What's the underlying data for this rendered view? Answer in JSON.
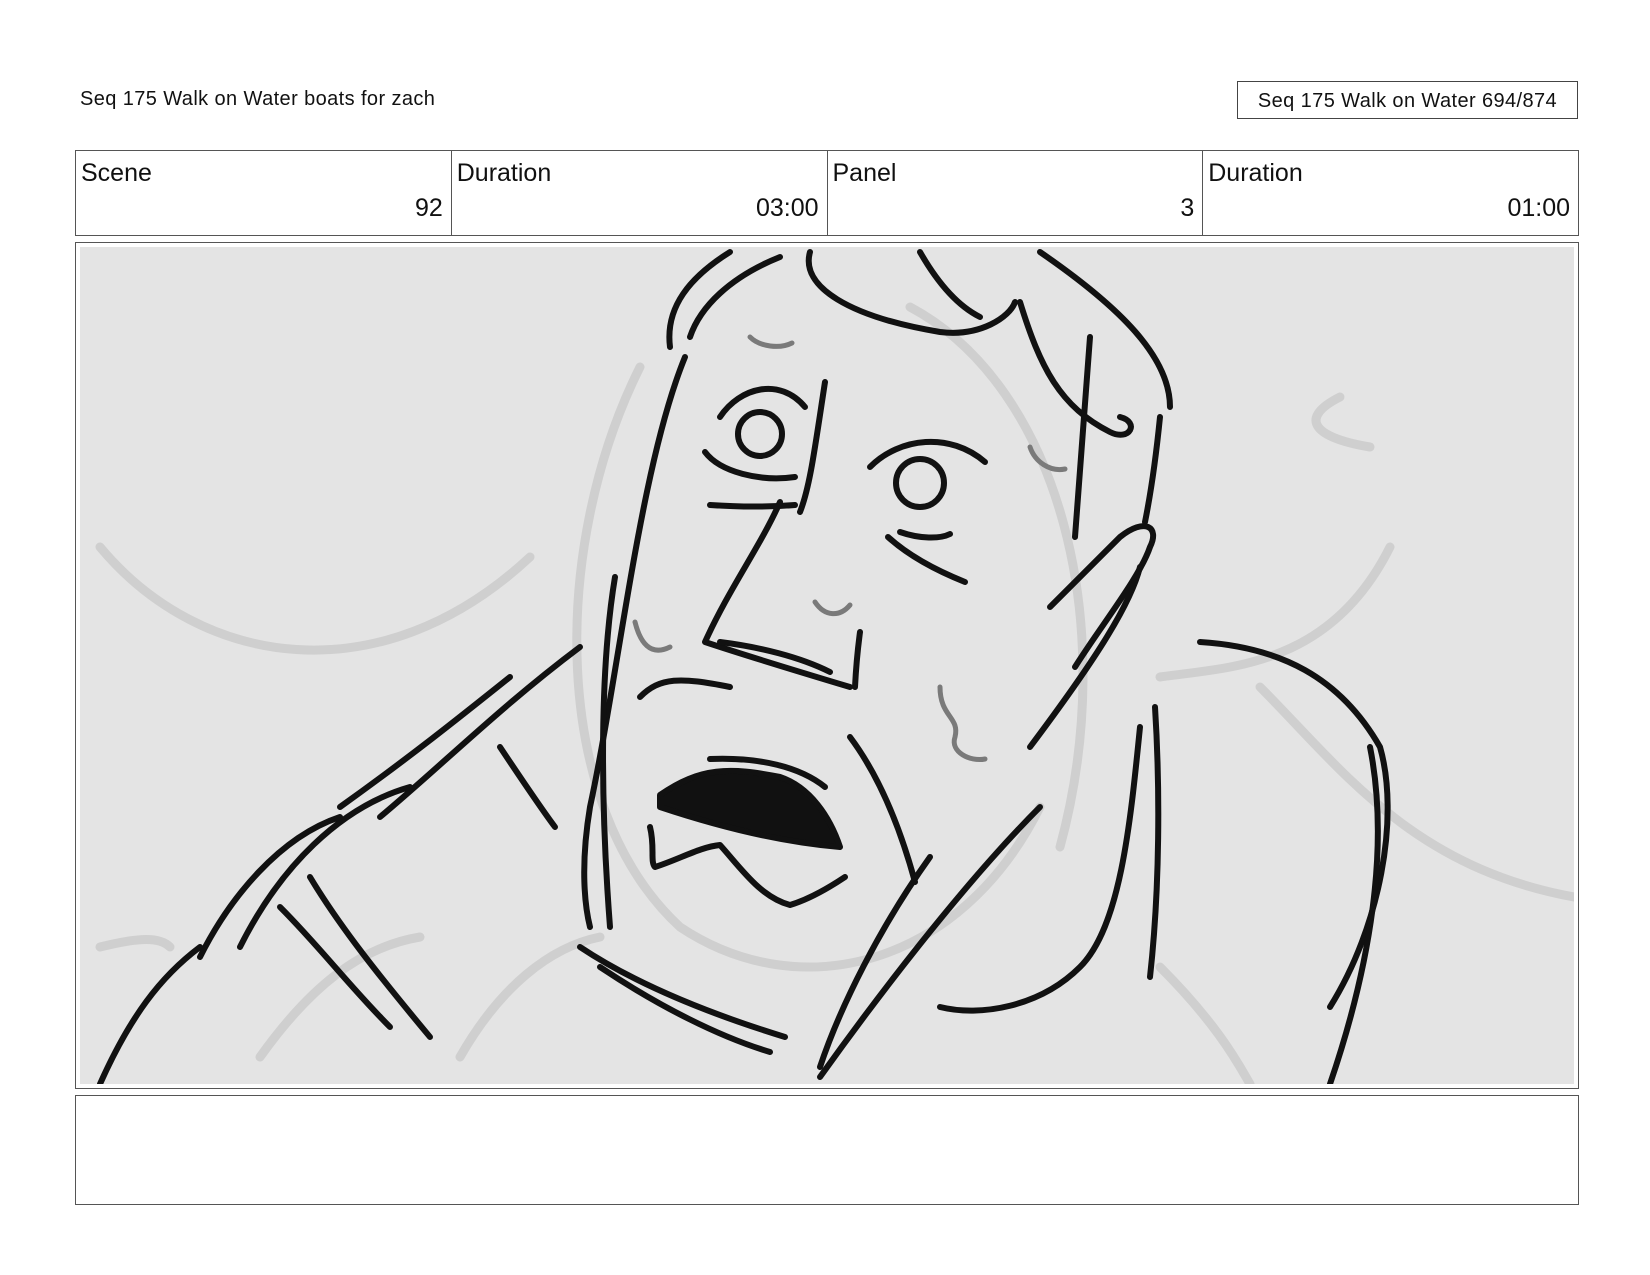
{
  "header": {
    "title": "Seq 175 Walk on Water  boats for zach",
    "page_counter": "Seq 175 Walk on Water 694/874"
  },
  "info": {
    "scene_label": "Scene",
    "scene_value": "92",
    "duration_label": "Duration",
    "duration_value": "03:00",
    "panel_label": "Panel",
    "panel_value": "3",
    "panel_duration_label": "Duration",
    "panel_duration_value": "01:00"
  },
  "panel": {
    "background_color": "#e4e4e4",
    "line_color": "#111111",
    "rough_line_color": "#cfcfcf"
  },
  "notes": {
    "text": ""
  }
}
